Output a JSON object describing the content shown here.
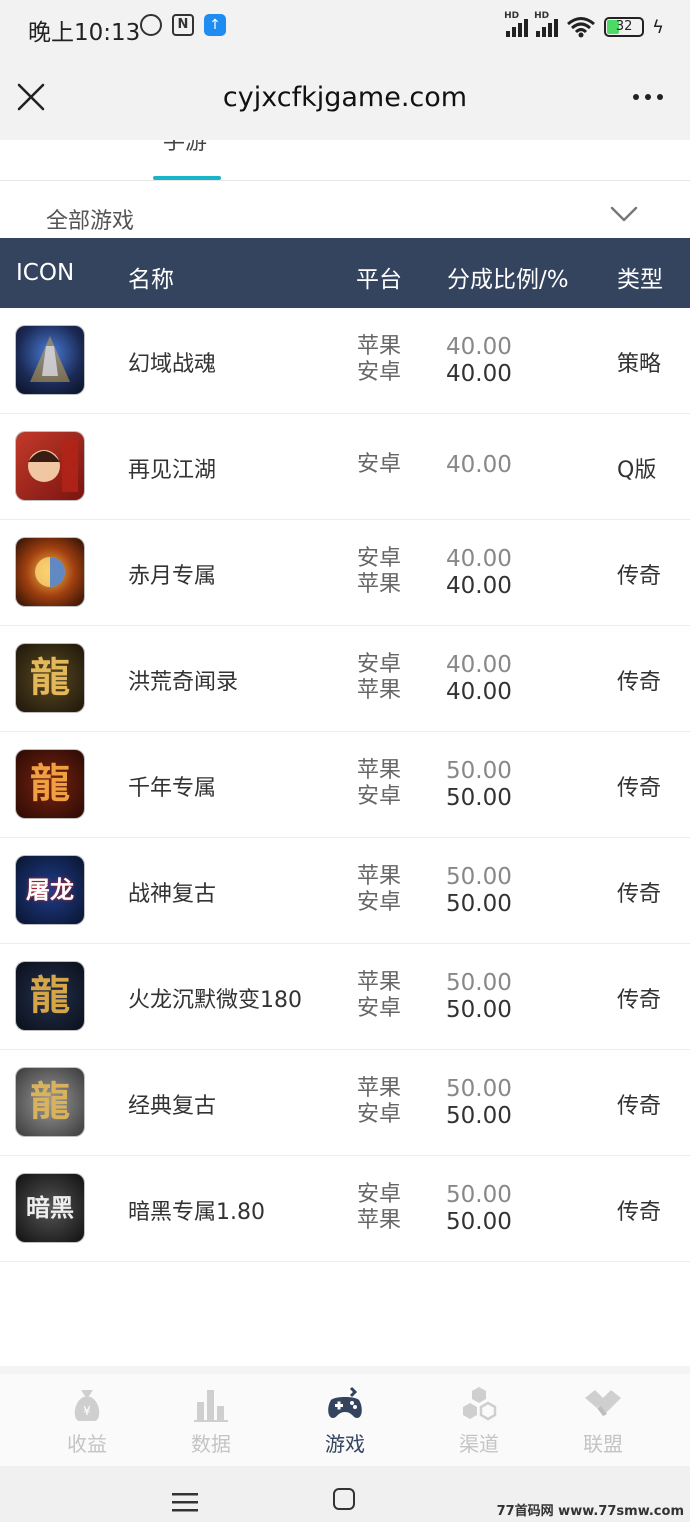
{
  "status_bar": {
    "time": "晚上10:13",
    "battery": "32",
    "signal_tag": "HD"
  },
  "header": {
    "title": "cyjxcfkjgame.com"
  },
  "tabs": {
    "active_label": "手游",
    "accent_color": "#18b5c8"
  },
  "filter": {
    "label": "全部游戏"
  },
  "table": {
    "header_bg": "#34445e",
    "columns": [
      "ICON",
      "名称",
      "平台",
      "分成比例/%",
      "类型"
    ],
    "rows": [
      {
        "icon": "fantasy-warrior-icon",
        "icon_glyph": "",
        "name": "幻域战魂",
        "platforms": [
          "苹果",
          "安卓"
        ],
        "ratios": [
          "40.00",
          "40.00"
        ],
        "type": "策略"
      },
      {
        "icon": "jianghu-hero-icon",
        "icon_glyph": "",
        "name": "再见江湖",
        "platforms": [
          "安卓"
        ],
        "ratios": [
          "40.00"
        ],
        "type": "Q版"
      },
      {
        "icon": "red-moon-orb-icon",
        "icon_glyph": "",
        "name": "赤月专属",
        "platforms": [
          "安卓",
          "苹果"
        ],
        "ratios": [
          "40.00",
          "40.00"
        ],
        "type": "传奇"
      },
      {
        "icon": "dragon-gold-icon",
        "icon_glyph": "龍",
        "name": "洪荒奇闻录",
        "platforms": [
          "安卓",
          "苹果"
        ],
        "ratios": [
          "40.00",
          "40.00"
        ],
        "type": "传奇"
      },
      {
        "icon": "dragon-red-icon",
        "icon_glyph": "龍",
        "name": "千年专属",
        "platforms": [
          "苹果",
          "安卓"
        ],
        "ratios": [
          "50.00",
          "50.00"
        ],
        "type": "传奇"
      },
      {
        "icon": "dragon-slayer-icon",
        "icon_glyph": "屠龙",
        "name": "战神复古",
        "platforms": [
          "苹果",
          "安卓"
        ],
        "ratios": [
          "50.00",
          "50.00"
        ],
        "type": "传奇"
      },
      {
        "icon": "dragon-blue-icon",
        "icon_glyph": "龍",
        "name": "火龙沉默微变180",
        "platforms": [
          "苹果",
          "安卓"
        ],
        "ratios": [
          "50.00",
          "50.00"
        ],
        "type": "传奇"
      },
      {
        "icon": "dragon-silver-icon",
        "icon_glyph": "龍",
        "name": "经典复古",
        "platforms": [
          "苹果",
          "安卓"
        ],
        "ratios": [
          "50.00",
          "50.00"
        ],
        "type": "传奇"
      },
      {
        "icon": "dark-exclusive-icon",
        "icon_glyph": "暗黑",
        "name": "暗黑专属1.80",
        "platforms": [
          "安卓",
          "苹果"
        ],
        "ratios": [
          "50.00",
          "50.00"
        ],
        "type": "传奇"
      }
    ]
  },
  "bottom_nav": {
    "items": [
      {
        "label": "收益",
        "icon": "money-bag-icon",
        "active": false
      },
      {
        "label": "数据",
        "icon": "bar-chart-icon",
        "active": false
      },
      {
        "label": "游戏",
        "icon": "gamepad-icon",
        "active": true
      },
      {
        "label": "渠道",
        "icon": "hexagons-icon",
        "active": false
      },
      {
        "label": "联盟",
        "icon": "handshake-icon",
        "active": false
      }
    ]
  },
  "watermark": "77首码网 www.77smw.com"
}
